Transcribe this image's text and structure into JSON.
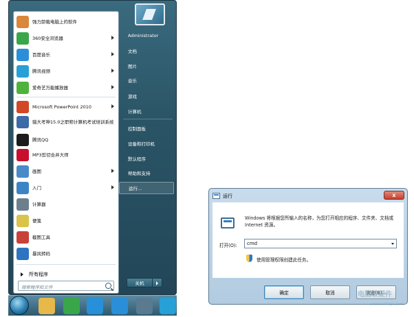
{
  "start_menu": {
    "programs": [
      {
        "label": "强力卸载电脑上的软件",
        "icon": "uninstall-icon",
        "color": "#d9873a",
        "arrow": false
      },
      {
        "label": "360安全浏览器",
        "icon": "browser-360-icon",
        "color": "#3aa64a",
        "arrow": true
      },
      {
        "label": "百度音乐",
        "icon": "baidu-music-icon",
        "color": "#2a8fd8",
        "arrow": true
      },
      {
        "label": "腾讯视频",
        "icon": "tencent-video-icon",
        "color": "#27a0d8",
        "arrow": true
      },
      {
        "label": "爱奇艺万能播放器",
        "icon": "iqiyi-player-icon",
        "color": "#4fb23a",
        "arrow": true
      },
      {
        "label": "Microsoft PowerPoint 2010",
        "icon": "powerpoint-icon",
        "color": "#d24726",
        "arrow": true
      },
      {
        "label": "猎大考神15.0之职称计算机考试培训系统",
        "icon": "exam-system-icon",
        "color": "#3d6aa8",
        "arrow": false
      },
      {
        "label": "腾讯QQ",
        "icon": "qq-icon",
        "color": "#1b1b1b",
        "arrow": false
      },
      {
        "label": "MP3剪切合并大师",
        "icon": "mp3-cut-icon",
        "color": "#c8102e",
        "arrow": false
      },
      {
        "label": "画图",
        "icon": "paint-icon",
        "color": "#4a8ac9",
        "arrow": true
      },
      {
        "label": "入门",
        "icon": "getting-started-icon",
        "color": "#3d84c6",
        "arrow": true
      },
      {
        "label": "计算器",
        "icon": "calculator-icon",
        "color": "#6d7f8c",
        "arrow": false
      },
      {
        "label": "便笺",
        "icon": "sticky-notes-icon",
        "color": "#d9c34a",
        "arrow": false
      },
      {
        "label": "截图工具",
        "icon": "snipping-tool-icon",
        "color": "#c8423a",
        "arrow": false
      },
      {
        "label": "暴风转码",
        "icon": "storm-codec-icon",
        "color": "#2c74c2",
        "arrow": false
      }
    ],
    "all_programs": "所有程序",
    "search_placeholder": "搜索程序和文件",
    "right_items": [
      {
        "label": "Administrator",
        "highlight": false
      },
      {
        "label": "文档",
        "highlight": false
      },
      {
        "label": "图片",
        "highlight": false
      },
      {
        "label": "音乐",
        "highlight": false
      },
      {
        "label": "游戏",
        "highlight": false
      },
      {
        "label": "计算机",
        "highlight": false
      },
      {
        "label": "控制面板",
        "highlight": false
      },
      {
        "label": "设备和打印机",
        "highlight": false
      },
      {
        "label": "默认程序",
        "highlight": false
      },
      {
        "label": "帮助和支持",
        "highlight": false
      },
      {
        "label": "运行...",
        "highlight": true
      }
    ],
    "shutdown_label": "关机"
  },
  "taskbar": {
    "icons": [
      {
        "name": "start-orb-icon"
      },
      {
        "name": "file-explorer-icon",
        "color": "#e8b84a"
      },
      {
        "name": "browser-360-taskbar-icon",
        "color": "#3aa64a"
      },
      {
        "name": "media-player-taskbar-icon",
        "color": "#2790d8"
      },
      {
        "name": "baidu-music-taskbar-icon",
        "color": "#2a8fd8"
      },
      {
        "name": "calculator-taskbar-icon",
        "color": "#5a7a90"
      },
      {
        "name": "tencent-video-taskbar-icon",
        "color": "#27a0d8"
      }
    ]
  },
  "run_dialog": {
    "title": "运行",
    "close": "x",
    "description": "Windows 将根据您所输入的名称，为您打开相应的程序、文件夹、文档或 Internet 资源。",
    "open_label": "打开(O):",
    "open_value": "cmd",
    "admin_note": "使用管理权限创建此任务。",
    "ok_label": "确定",
    "cancel_label": "取消",
    "browse_label": "浏览(B)..."
  },
  "watermark": {
    "main": "电脑软硬件",
    "sub": "www.cnfapi.com"
  }
}
